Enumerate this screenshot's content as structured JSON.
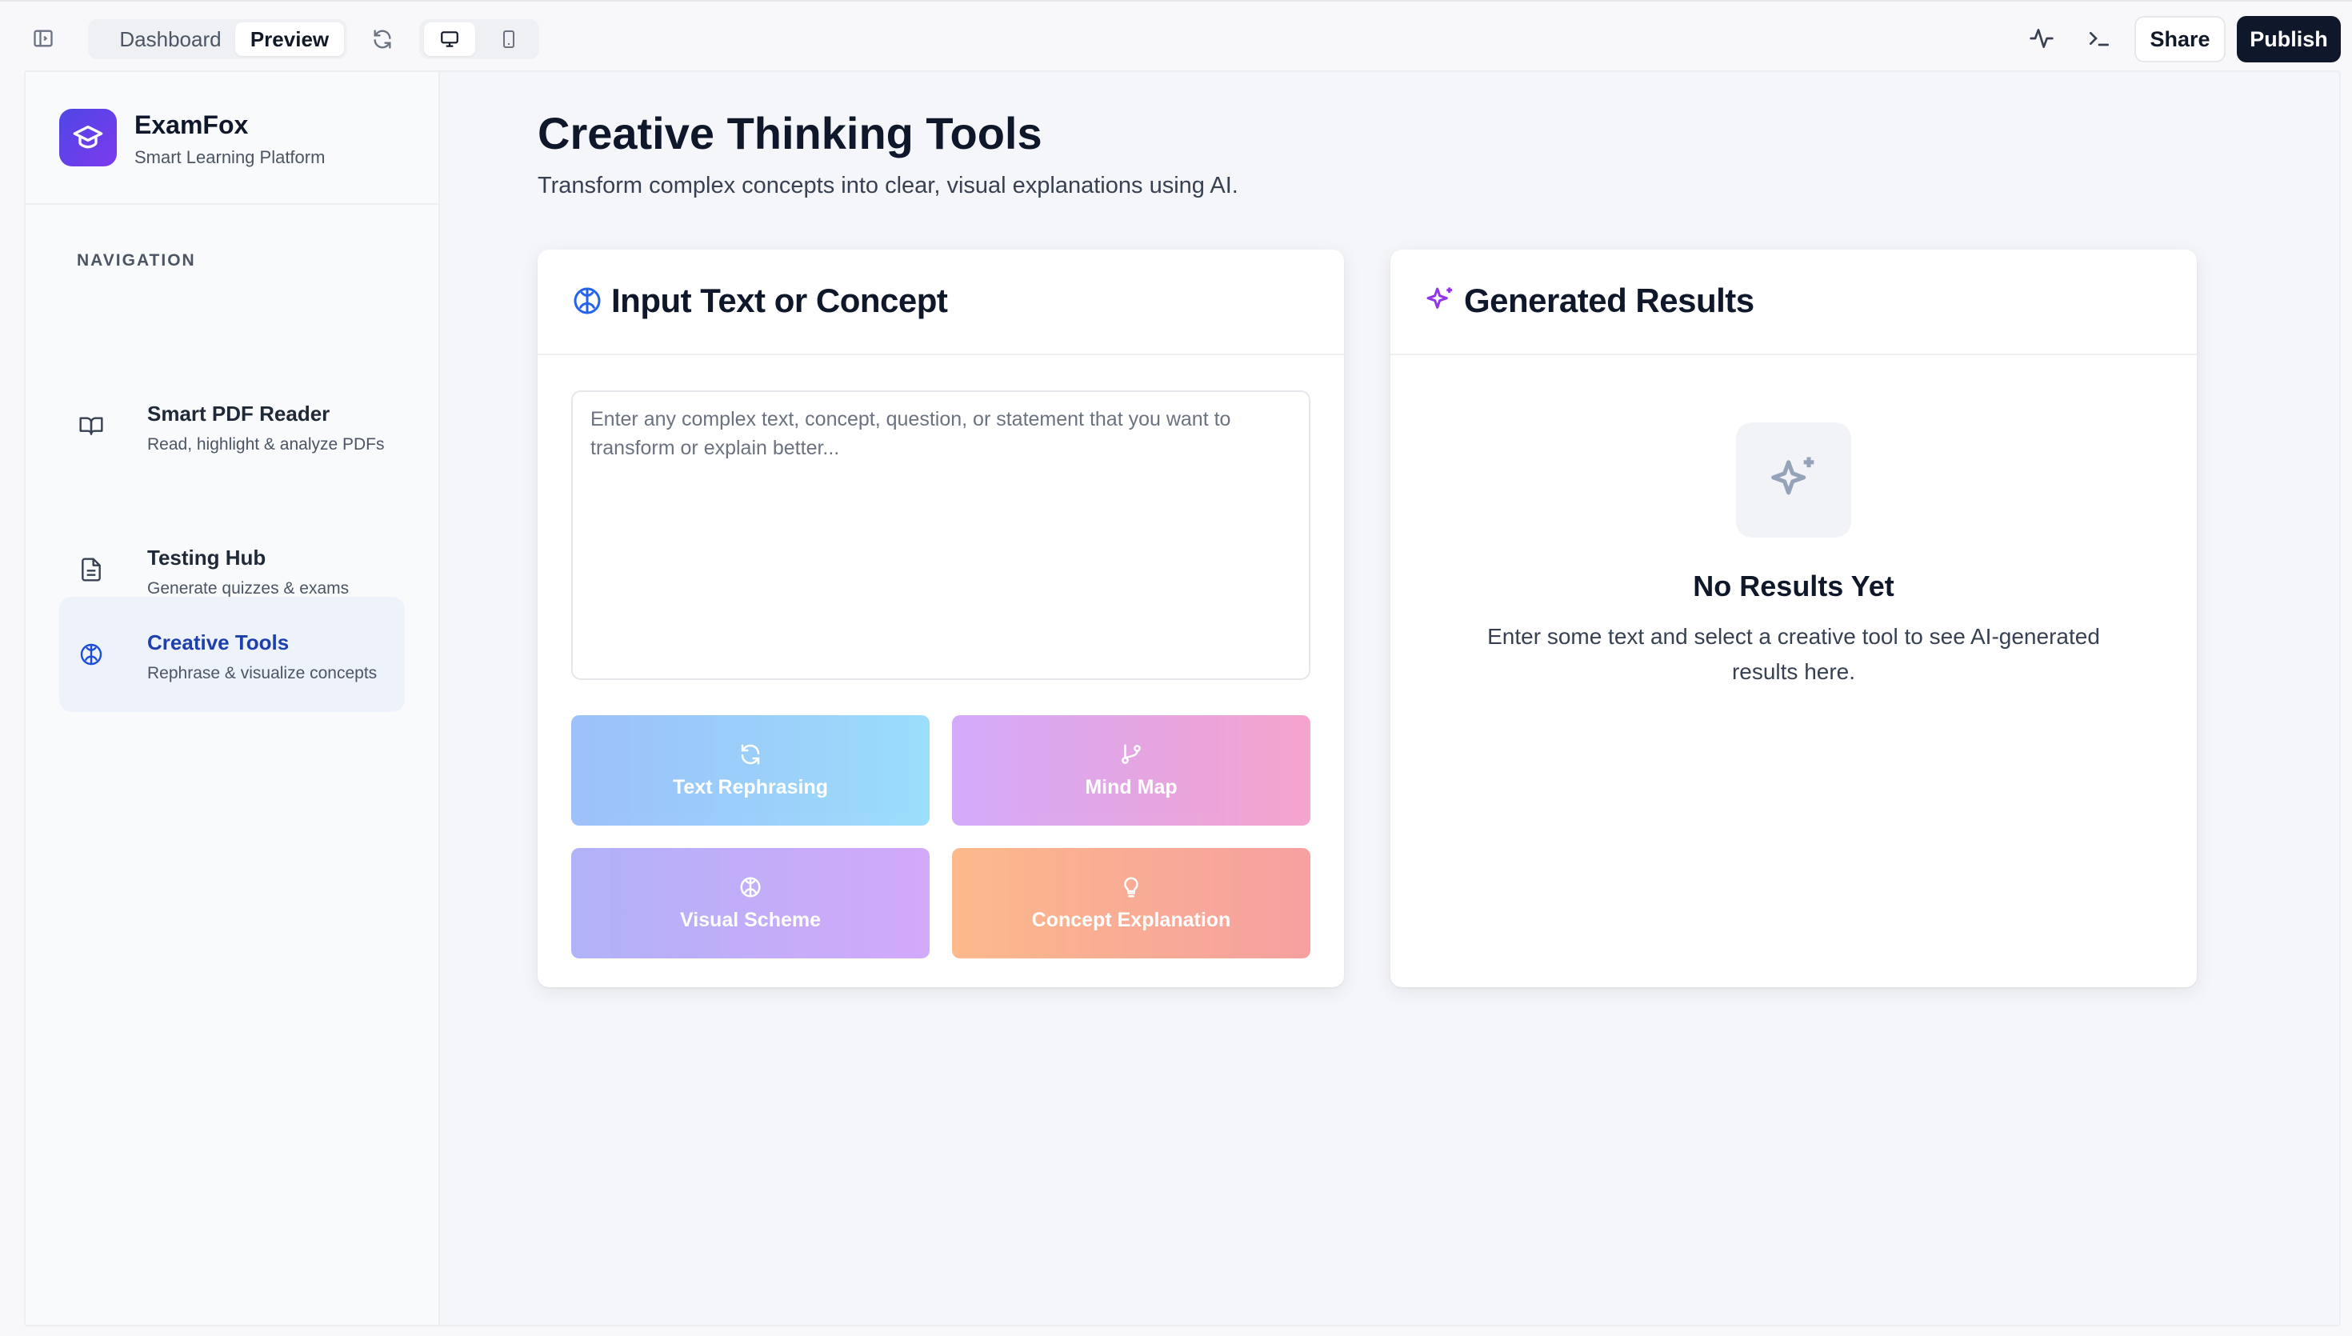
{
  "topbar": {
    "tabs": [
      {
        "label": "Dashboard",
        "active": false
      },
      {
        "label": "Preview",
        "active": true
      }
    ],
    "share_label": "Share",
    "publish_label": "Publish",
    "icons": [
      "sidebar-toggle-icon",
      "refresh-icon",
      "desktop-icon",
      "mobile-icon",
      "activity-icon",
      "terminal-icon"
    ]
  },
  "brand": {
    "name": "ExamFox",
    "subtitle": "Smart Learning Platform"
  },
  "sidebar": {
    "heading": "NAVIGATION",
    "items": [
      {
        "title": "Smart PDF Reader",
        "desc": "Read, highlight & analyze PDFs",
        "icon": "book-icon",
        "active": false
      },
      {
        "title": "Testing Hub",
        "desc": "Generate quizzes & exams",
        "icon": "document-icon",
        "active": false
      },
      {
        "title": "Creative Tools",
        "desc": "Rephrase & visualize concepts",
        "icon": "brain-icon",
        "active": true
      }
    ]
  },
  "main": {
    "title": "Creative Thinking Tools",
    "subtitle": "Transform complex concepts into clear, visual explanations using AI.",
    "input_card": {
      "title": "Input Text or Concept",
      "placeholder": "Enter any complex text, concept, question, or statement that you want to transform or explain better...",
      "value": "",
      "tools": [
        {
          "label": "Text Rephrasing",
          "icon": "refresh-icon"
        },
        {
          "label": "Mind Map",
          "icon": "git-branch-icon"
        },
        {
          "label": "Visual Scheme",
          "icon": "brain-icon"
        },
        {
          "label": "Concept Explanation",
          "icon": "lightbulb-icon"
        }
      ]
    },
    "results_card": {
      "title": "Generated Results",
      "empty_title": "No Results Yet",
      "empty_desc": "Enter some text and select a creative tool to see AI-generated results here."
    }
  },
  "colors": {
    "accent": "#1e40af",
    "publish_bg": "#0f172a",
    "logo_gradient": [
      "#4f46e5",
      "#7c3aed"
    ],
    "sparkle": "#9333ea"
  }
}
